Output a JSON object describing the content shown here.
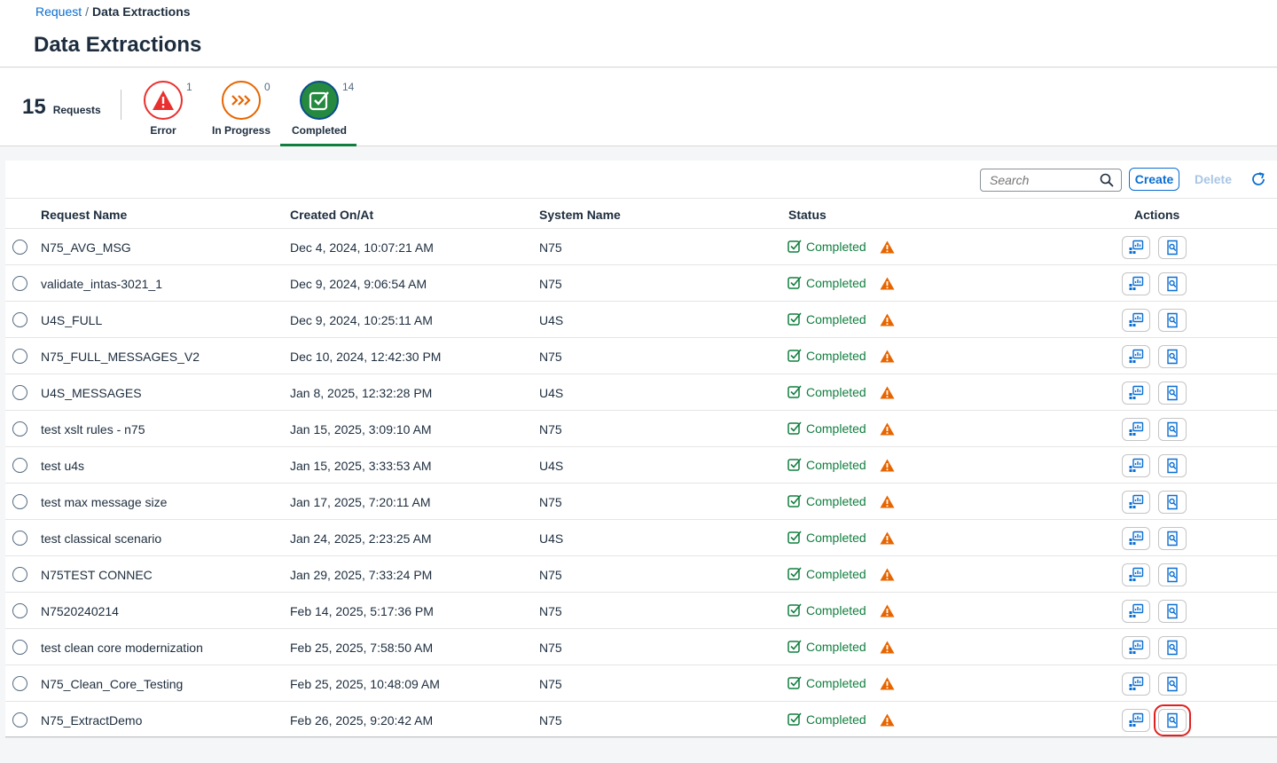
{
  "breadcrumb": {
    "parent": "Request",
    "separator": "/",
    "current": "Data Extractions"
  },
  "page_title": "Data Extractions",
  "summary": {
    "total": "15",
    "total_label": "Requests"
  },
  "icon_tabs": [
    {
      "label": "Error",
      "count": "1",
      "icon": "alert-triangle-icon",
      "color": "#e9302f"
    },
    {
      "label": "In Progress",
      "count": "0",
      "icon": "chevron-right-triple-icon",
      "color": "#e76500"
    },
    {
      "label": "Completed",
      "count": "14",
      "icon": "check-square-icon",
      "color": "#25893f",
      "selected": true
    }
  ],
  "toolbar": {
    "search_placeholder": "Search",
    "create_label": "Create",
    "delete_label": "Delete"
  },
  "columns": {
    "name": "Request Name",
    "created": "Created On/At",
    "system": "System Name",
    "status": "Status",
    "actions": "Actions"
  },
  "colors": {
    "link": "#0a6ed1",
    "success": "#107e3e",
    "warning": "#e76500",
    "highlight": "#e02020"
  },
  "rows": [
    {
      "name": "N75_AVG_MSG",
      "created": "Dec 4, 2024, 10:07:21 AM",
      "system": "N75",
      "status": "Completed"
    },
    {
      "name": "validate_intas-3021_1",
      "created": "Dec 9, 2024, 9:06:54 AM",
      "system": "N75",
      "status": "Completed"
    },
    {
      "name": "U4S_FULL",
      "created": "Dec 9, 2024, 10:25:11 AM",
      "system": "U4S",
      "status": "Completed"
    },
    {
      "name": "N75_FULL_MESSAGES_V2",
      "created": "Dec 10, 2024, 12:42:30 PM",
      "system": "N75",
      "status": "Completed"
    },
    {
      "name": "U4S_MESSAGES",
      "created": "Jan 8, 2025, 12:32:28 PM",
      "system": "U4S",
      "status": "Completed"
    },
    {
      "name": "test xslt rules - n75",
      "created": "Jan 15, 2025, 3:09:10 AM",
      "system": "N75",
      "status": "Completed"
    },
    {
      "name": "test u4s",
      "created": "Jan 15, 2025, 3:33:53 AM",
      "system": "U4S",
      "status": "Completed"
    },
    {
      "name": "test max message size",
      "created": "Jan 17, 2025, 7:20:11 AM",
      "system": "N75",
      "status": "Completed"
    },
    {
      "name": "test classical scenario",
      "created": "Jan 24, 2025, 2:23:25 AM",
      "system": "U4S",
      "status": "Completed"
    },
    {
      "name": "N75TEST CONNEC",
      "created": "Jan 29, 2025, 7:33:24 PM",
      "system": "N75",
      "status": "Completed"
    },
    {
      "name": "N7520240214",
      "created": "Feb 14, 2025, 5:17:36 PM",
      "system": "N75",
      "status": "Completed"
    },
    {
      "name": "test clean core modernization",
      "created": "Feb 25, 2025, 7:58:50 AM",
      "system": "N75",
      "status": "Completed"
    },
    {
      "name": "N75_Clean_Core_Testing",
      "created": "Feb 25, 2025, 10:48:09 AM",
      "system": "N75",
      "status": "Completed"
    },
    {
      "name": "N75_ExtractDemo",
      "created": "Feb 26, 2025, 9:20:42 AM",
      "system": "N75",
      "status": "Completed",
      "highlighted_action": "view-report"
    }
  ]
}
